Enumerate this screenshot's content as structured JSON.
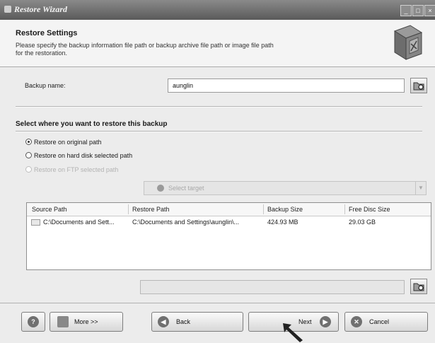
{
  "window": {
    "title": "Restore Wizard",
    "controls": [
      "_",
      "□",
      "×"
    ]
  },
  "header": {
    "title": "Restore Settings",
    "description_line1": "Please specify the backup information file path or backup archive file path or image file path",
    "description_line2": "for the restoration.",
    "icon": "backup-cube-icon"
  },
  "backup_name": {
    "label": "Backup name:",
    "value": "aunglin",
    "browse_icon": "browse-folder-icon"
  },
  "restore_location": {
    "section_title": "Select where you want to restore this backup",
    "options": [
      {
        "label": "Restore on original path",
        "selected": true,
        "enabled": true
      },
      {
        "label": "Restore on hard disk selected path",
        "selected": false,
        "enabled": true
      },
      {
        "label": "Restore on FTP selected path",
        "selected": false,
        "enabled": false
      }
    ],
    "target_label": "",
    "target_placeholder": "Select target"
  },
  "table": {
    "columns": [
      "Source Path",
      "Restore Path",
      "Backup Size",
      "Free Disc Size"
    ],
    "rows": [
      {
        "source_path": "C:\\Documents and Sett...",
        "restore_path": "C:\\Documents and Settings\\aunglin\\...",
        "backup_size": "424.93 MB",
        "free_disc_size": "29.03 GB"
      }
    ]
  },
  "restore_path": {
    "label": "",
    "value": ""
  },
  "buttons": {
    "help": "?",
    "more": "More >>",
    "back": "Back",
    "next": "Next",
    "cancel": "Cancel"
  },
  "colors": {
    "title_bar": "#6e6e6e",
    "window_bg": "#ececec",
    "header_bg": "#f4f4f4"
  }
}
